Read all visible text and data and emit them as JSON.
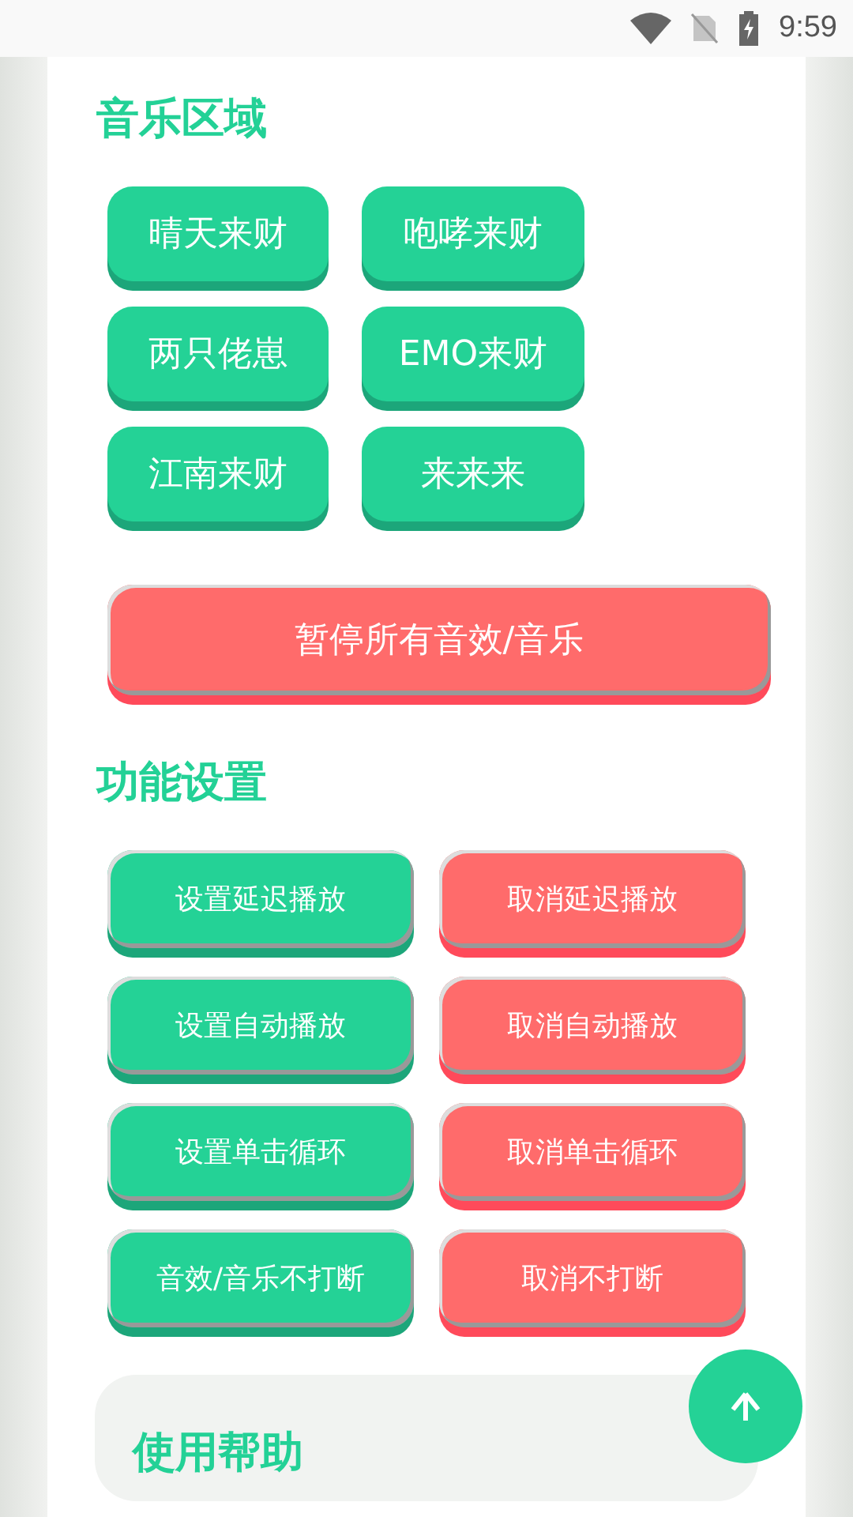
{
  "status_bar": {
    "time": "9:59"
  },
  "music_section": {
    "title": "音乐区域",
    "buttons": [
      {
        "label": "晴天来财"
      },
      {
        "label": "咆哮来财"
      },
      {
        "label": "两只佬崽"
      },
      {
        "label": "EMO来财"
      },
      {
        "label": "江南来财"
      },
      {
        "label": "来来来"
      }
    ],
    "stop_button": "暂停所有音效/音乐"
  },
  "settings_section": {
    "title": "功能设置",
    "buttons": [
      {
        "label": "设置延迟播放",
        "kind": "set"
      },
      {
        "label": "取消延迟播放",
        "kind": "cancel"
      },
      {
        "label": "设置自动播放",
        "kind": "set"
      },
      {
        "label": "取消自动播放",
        "kind": "cancel"
      },
      {
        "label": "设置单击循环",
        "kind": "set"
      },
      {
        "label": "取消单击循环",
        "kind": "cancel"
      },
      {
        "label": "音效/音乐不打断",
        "kind": "set"
      },
      {
        "label": "取消不打断",
        "kind": "cancel"
      }
    ]
  },
  "help_card": {
    "title": "使用帮助"
  }
}
